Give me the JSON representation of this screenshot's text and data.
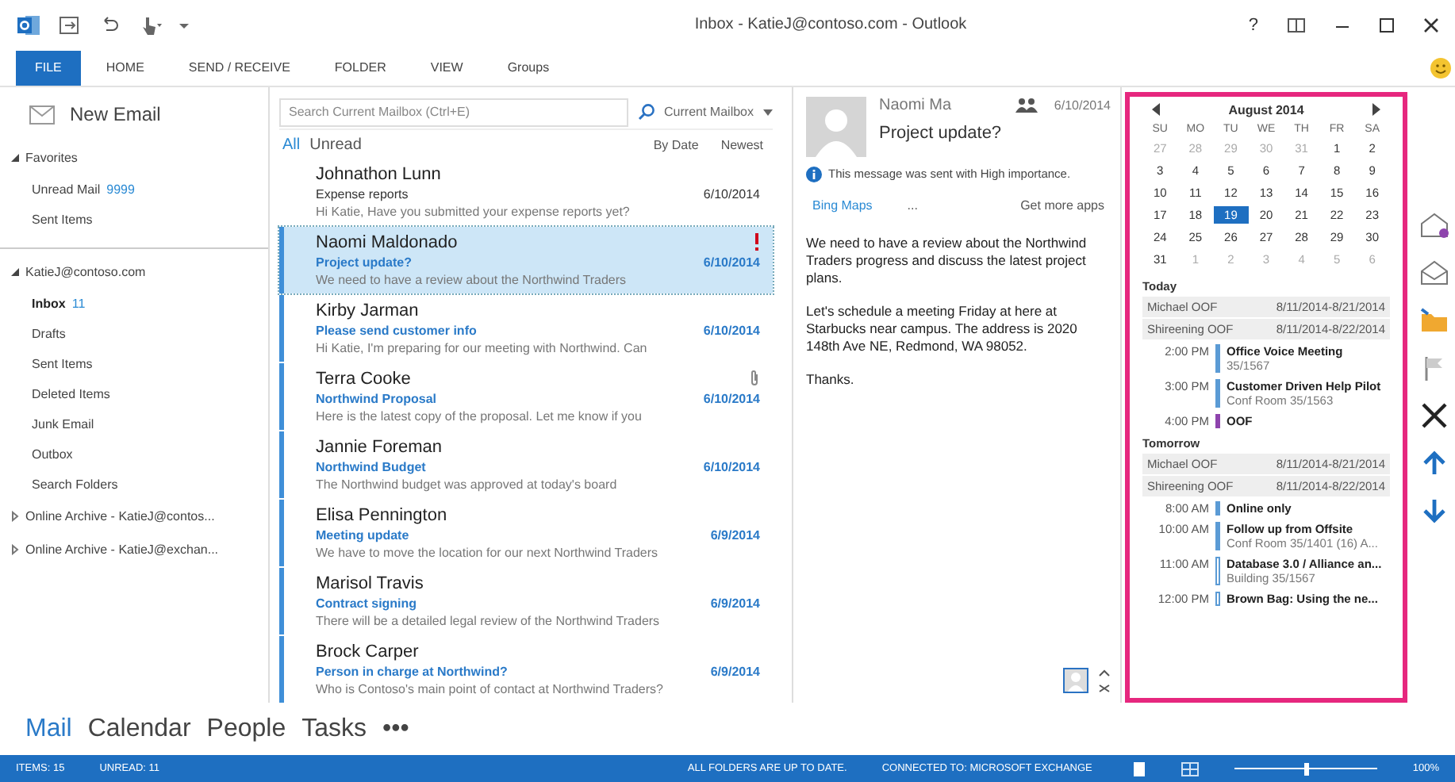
{
  "window": {
    "title": "Inbox - KatieJ@contoso.com - Outlook",
    "help": "?"
  },
  "ribbon_tabs": [
    {
      "label": "FILE",
      "selected": true
    },
    {
      "label": "HOME",
      "selected": false
    },
    {
      "label": "SEND / RECEIVE",
      "selected": false
    },
    {
      "label": "FOLDER",
      "selected": false
    },
    {
      "label": "VIEW",
      "selected": false
    },
    {
      "label": "Groups",
      "selected": false
    }
  ],
  "folder_pane": {
    "new_email": "New Email",
    "groups": [
      {
        "label": "Favorites",
        "expanded": true,
        "children": [
          {
            "label": "Unread Mail",
            "count": "9999",
            "selected": false
          },
          {
            "label": "Sent Items",
            "selected": false
          }
        ]
      },
      {
        "label": "KatieJ@contoso.com",
        "expanded": true,
        "children": [
          {
            "label": "Inbox",
            "count": "11",
            "selected": true
          },
          {
            "label": "Drafts",
            "selected": false
          },
          {
            "label": "Sent Items",
            "selected": false
          },
          {
            "label": "Deleted Items",
            "selected": false
          },
          {
            "label": "Junk Email",
            "selected": false
          },
          {
            "label": "Outbox",
            "selected": false
          },
          {
            "label": "Search Folders",
            "selected": false
          }
        ]
      },
      {
        "label": "Online Archive - KatieJ@contos...",
        "expanded": false
      },
      {
        "label": "Online Archive - KatieJ@exchan...",
        "expanded": false
      }
    ]
  },
  "message_list": {
    "search": {
      "placeholder": "Search Current Mailbox (Ctrl+E)",
      "scope": "Current Mailbox"
    },
    "filters": [
      {
        "label": "All",
        "selected": true
      },
      {
        "label": "Unread",
        "selected": false
      }
    ],
    "sort": "By Date",
    "order": "Newest",
    "messages": [
      {
        "sender": "Johnathon Lunn",
        "subject": "Expense reports",
        "preview": "Hi Katie, Have you submitted your expense reports yet?",
        "date": "6/10/2014",
        "unread": false,
        "selected": false,
        "important": false,
        "attachment": false
      },
      {
        "sender": "Naomi Maldonado",
        "subject": "Project update?",
        "preview": "We need to have a review about the Northwind Traders",
        "date": "6/10/2014",
        "unread": true,
        "selected": true,
        "important": true,
        "attachment": false
      },
      {
        "sender": "Kirby Jarman",
        "subject": "Please send customer info",
        "preview": "Hi Katie, I'm preparing for our meeting with Northwind. Can",
        "date": "6/10/2014",
        "unread": true,
        "selected": false,
        "important": false,
        "attachment": false
      },
      {
        "sender": "Terra Cooke",
        "subject": "Northwind Proposal",
        "preview": "Here is the latest copy of the proposal. Let me know if you",
        "date": "6/10/2014",
        "unread": true,
        "selected": false,
        "important": false,
        "attachment": true
      },
      {
        "sender": "Jannie Foreman",
        "subject": "Northwind Budget",
        "preview": "The Northwind budget was approved at today's board",
        "date": "6/10/2014",
        "unread": true,
        "selected": false,
        "important": false,
        "attachment": false
      },
      {
        "sender": "Elisa Pennington",
        "subject": "Meeting update",
        "preview": "We have to move the location for our next Northwind Traders",
        "date": "6/9/2014",
        "unread": true,
        "selected": false,
        "important": false,
        "attachment": false
      },
      {
        "sender": "Marisol Travis",
        "subject": "Contract signing",
        "preview": "There will be a detailed legal review of the Northwind Traders",
        "date": "6/9/2014",
        "unread": true,
        "selected": false,
        "important": false,
        "attachment": false
      },
      {
        "sender": "Brock Carper",
        "subject": "Person in charge at Northwind?",
        "preview": "Who is Contoso's main point of contact at Northwind Traders?",
        "date": "6/9/2014",
        "unread": true,
        "selected": false,
        "important": false,
        "attachment": false
      }
    ]
  },
  "reading_pane": {
    "sender": "Naomi Ma",
    "date": "6/10/2014",
    "subject": "Project update?",
    "info": "This message was sent with High importance.",
    "apps": [
      "Bing Maps",
      "..."
    ],
    "more_apps": "Get more apps",
    "body": [
      "We need to have a review about the Northwind Traders progress and discuss the latest project plans.",
      "Let's schedule a meeting Friday at here at Starbucks near campus.  The address is 2020 148th Ave NE, Redmond, WA 98052.",
      "Thanks."
    ]
  },
  "calendar_peek": {
    "month": "August 2014",
    "weekdays": [
      "SU",
      "MO",
      "TU",
      "WE",
      "TH",
      "FR",
      "SA"
    ],
    "weeks": [
      [
        {
          "day": "27",
          "in_month": false,
          "selected": false
        },
        {
          "day": "28",
          "in_month": false,
          "selected": false
        },
        {
          "day": "29",
          "in_month": false,
          "selected": false
        },
        {
          "day": "30",
          "in_month": false,
          "selected": false
        },
        {
          "day": "31",
          "in_month": false,
          "selected": false
        },
        {
          "day": "1",
          "in_month": true,
          "selected": false
        },
        {
          "day": "2",
          "in_month": true,
          "selected": false
        }
      ],
      [
        {
          "day": "3",
          "in_month": true,
          "selected": false
        },
        {
          "day": "4",
          "in_month": true,
          "selected": false
        },
        {
          "day": "5",
          "in_month": true,
          "selected": false
        },
        {
          "day": "6",
          "in_month": true,
          "selected": false
        },
        {
          "day": "7",
          "in_month": true,
          "selected": false
        },
        {
          "day": "8",
          "in_month": true,
          "selected": false
        },
        {
          "day": "9",
          "in_month": true,
          "selected": false
        }
      ],
      [
        {
          "day": "10",
          "in_month": true,
          "selected": false
        },
        {
          "day": "11",
          "in_month": true,
          "selected": false
        },
        {
          "day": "12",
          "in_month": true,
          "selected": false
        },
        {
          "day": "13",
          "in_month": true,
          "selected": false
        },
        {
          "day": "14",
          "in_month": true,
          "selected": false
        },
        {
          "day": "15",
          "in_month": true,
          "selected": false
        },
        {
          "day": "16",
          "in_month": true,
          "selected": false
        }
      ],
      [
        {
          "day": "17",
          "in_month": true,
          "selected": false
        },
        {
          "day": "18",
          "in_month": true,
          "selected": false
        },
        {
          "day": "19",
          "in_month": true,
          "selected": true
        },
        {
          "day": "20",
          "in_month": true,
          "selected": false
        },
        {
          "day": "21",
          "in_month": true,
          "selected": false
        },
        {
          "day": "22",
          "in_month": true,
          "selected": false
        },
        {
          "day": "23",
          "in_month": true,
          "selected": false
        }
      ],
      [
        {
          "day": "24",
          "in_month": true,
          "selected": false
        },
        {
          "day": "25",
          "in_month": true,
          "selected": false
        },
        {
          "day": "26",
          "in_month": true,
          "selected": false
        },
        {
          "day": "27",
          "in_month": true,
          "selected": false
        },
        {
          "day": "28",
          "in_month": true,
          "selected": false
        },
        {
          "day": "29",
          "in_month": true,
          "selected": false
        },
        {
          "day": "30",
          "in_month": true,
          "selected": false
        }
      ],
      [
        {
          "day": "31",
          "in_month": true,
          "selected": false
        },
        {
          "day": "1",
          "in_month": false,
          "selected": false
        },
        {
          "day": "2",
          "in_month": false,
          "selected": false
        },
        {
          "day": "3",
          "in_month": false,
          "selected": false
        },
        {
          "day": "4",
          "in_month": false,
          "selected": false
        },
        {
          "day": "5",
          "in_month": false,
          "selected": false
        },
        {
          "day": "6",
          "in_month": false,
          "selected": false
        }
      ]
    ],
    "agenda": [
      {
        "heading": "Today",
        "all_day": [
          {
            "title": "Michael OOF",
            "dates": "8/11/2014-8/21/2014"
          },
          {
            "title": "Shireening OOF",
            "dates": "8/11/2014-8/22/2014"
          }
        ],
        "events": [
          {
            "time": "2:00 PM",
            "title": "Office Voice Meeting",
            "location": "35/1567",
            "color": "#5b9bd5",
            "kind": "busy"
          },
          {
            "time": "3:00 PM",
            "title": "Customer Driven Help Pilot",
            "location": "Conf Room 35/1563",
            "color": "#5b9bd5",
            "kind": "busy"
          },
          {
            "time": "4:00 PM",
            "title": "OOF",
            "color": "#8e44ad",
            "kind": "busy"
          }
        ]
      },
      {
        "heading": "Tomorrow",
        "all_day": [
          {
            "title": "Michael OOF",
            "dates": "8/11/2014-8/21/2014"
          },
          {
            "title": "Shireening OOF",
            "dates": "8/11/2014-8/22/2014"
          }
        ],
        "events": [
          {
            "time": "8:00 AM",
            "title": "Online only",
            "color": "#5b9bd5",
            "kind": "busy"
          },
          {
            "time": "10:00 AM",
            "title": "Follow up from Offsite",
            "location": "Conf Room 35/1401 (16) A...",
            "color": "#5b9bd5",
            "kind": "busy"
          },
          {
            "time": "11:00 AM",
            "title": "Database 3.0 / Alliance an...",
            "location": "Building 35/1567",
            "color": "#5b9bd5",
            "kind": "tentative"
          },
          {
            "time": "12:00 PM",
            "title": "Brown Bag: Using the ne...",
            "color": "#5b9bd5",
            "kind": "tentative"
          }
        ]
      }
    ]
  },
  "nav": [
    {
      "label": "Mail",
      "selected": true
    },
    {
      "label": "Calendar",
      "selected": false
    },
    {
      "label": "People",
      "selected": false
    },
    {
      "label": "Tasks",
      "selected": false
    },
    {
      "label": "•••",
      "selected": false
    }
  ],
  "status_bar": {
    "items": "ITEMS: 15",
    "unread": "UNREAD: 11",
    "sync": "ALL FOLDERS ARE UP TO DATE.",
    "connection": "CONNECTED TO: MICROSOFT EXCHANGE",
    "zoom": {
      "level": 0.5,
      "reading": "100%"
    }
  }
}
